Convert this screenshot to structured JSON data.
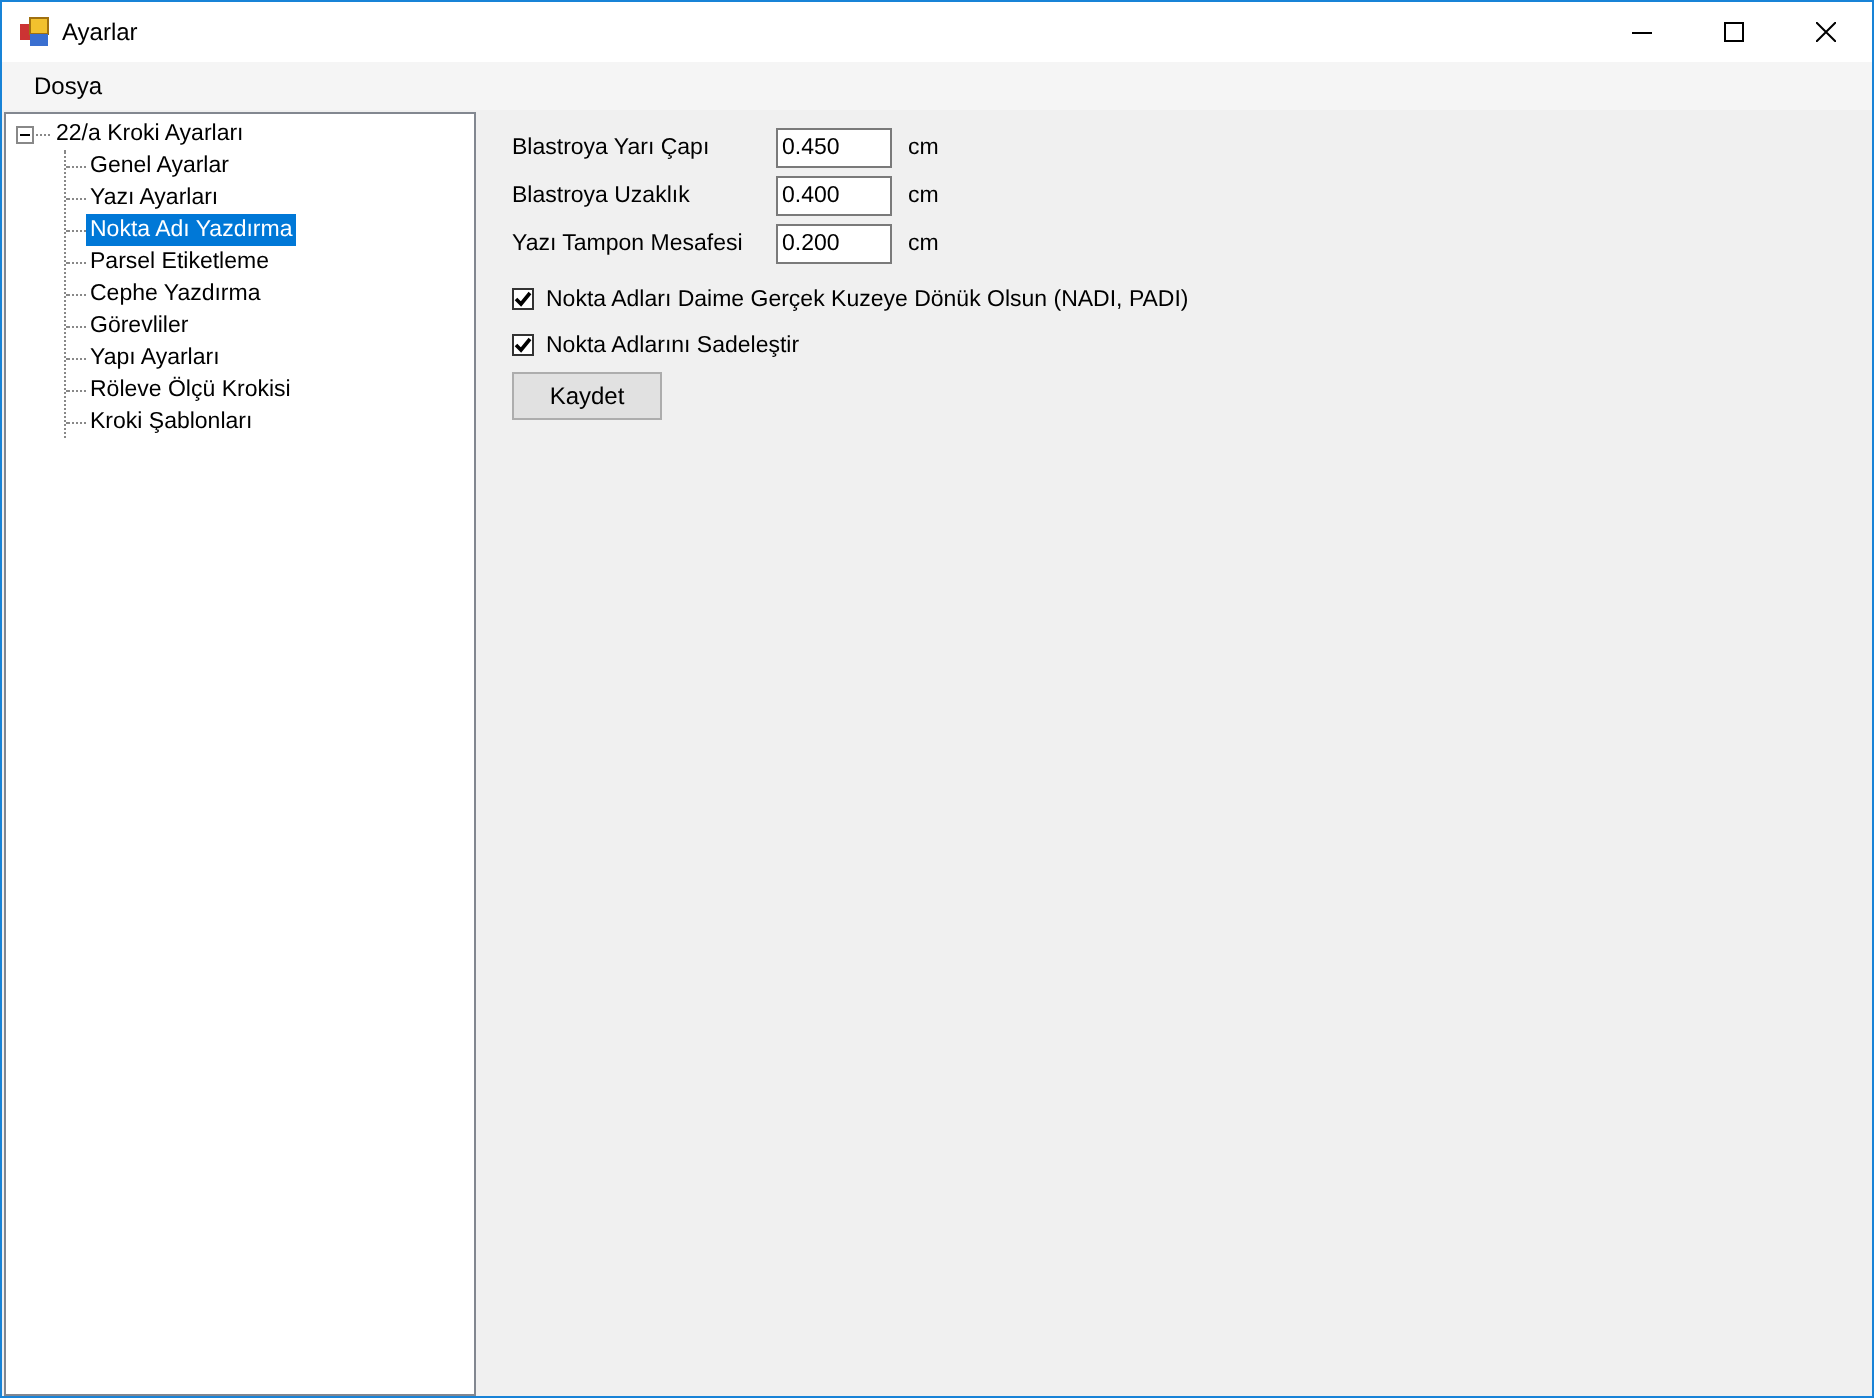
{
  "window": {
    "title": "Ayarlar"
  },
  "menu": [
    "Dosya"
  ],
  "tree": {
    "label": "22/a Kroki Ayarları",
    "expanded": true,
    "children": [
      {
        "label": "Genel Ayarlar",
        "selected": false
      },
      {
        "label": "Yazı Ayarları",
        "selected": false
      },
      {
        "label": "Nokta Adı Yazdırma",
        "selected": true
      },
      {
        "label": "Parsel Etiketleme",
        "selected": false
      },
      {
        "label": "Cephe Yazdırma",
        "selected": false
      },
      {
        "label": "Görevliler",
        "selected": false
      },
      {
        "label": "Yapı Ayarları",
        "selected": false
      },
      {
        "label": "Röleve Ölçü Krokisi",
        "selected": false
      },
      {
        "label": "Kroki Şablonları",
        "selected": false
      }
    ]
  },
  "fields": [
    {
      "label": "Blastroya Yarı Çapı",
      "value": "0.450",
      "unit": "cm"
    },
    {
      "label": "Blastroya Uzaklık",
      "value": "0.400",
      "unit": "cm"
    },
    {
      "label": "Yazı Tampon Mesafesi",
      "value": "0.200",
      "unit": "cm"
    }
  ],
  "checkboxes": [
    {
      "label": "Nokta Adları Daime Gerçek Kuzeye Dönük Olsun (NADI, PADI)",
      "checked": true
    },
    {
      "label": "Nokta Adlarını Sadeleştir",
      "checked": true
    }
  ],
  "buttons": [
    "Kaydet"
  ]
}
